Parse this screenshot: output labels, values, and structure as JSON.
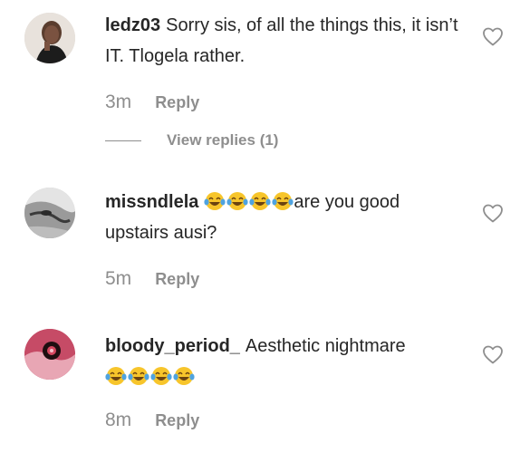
{
  "comments": [
    {
      "username": "ledz03",
      "text": "Sorry sis, of all the things this, it isn’t IT. Tlogela rather.",
      "time": "3m",
      "reply_label": "Reply",
      "avatar_icon": "user-avatar"
    },
    {
      "username": "missndlela",
      "emoji": [
        "tears-of-joy",
        "tears-of-joy",
        "tears-of-joy",
        "tears-of-joy"
      ],
      "text": "are you good upstairs ausi?",
      "time": "5m",
      "reply_label": "Reply",
      "avatar_icon": "user-avatar"
    },
    {
      "username": "bloody_period_",
      "text": "Aesthetic nightmare",
      "emoji": [
        "tears-of-joy",
        "tears-of-joy",
        "tears-of-joy",
        "tears-of-joy"
      ],
      "time": "8m",
      "reply_label": "Reply",
      "avatar_icon": "user-avatar"
    }
  ],
  "view_replies_label": "View replies (1)",
  "colors": {
    "text": "#262626",
    "muted": "#8e8e8e",
    "background": "#ffffff"
  },
  "icons": {
    "like": "heart-outline-icon",
    "emoji": "face-with-tears-of-joy"
  }
}
